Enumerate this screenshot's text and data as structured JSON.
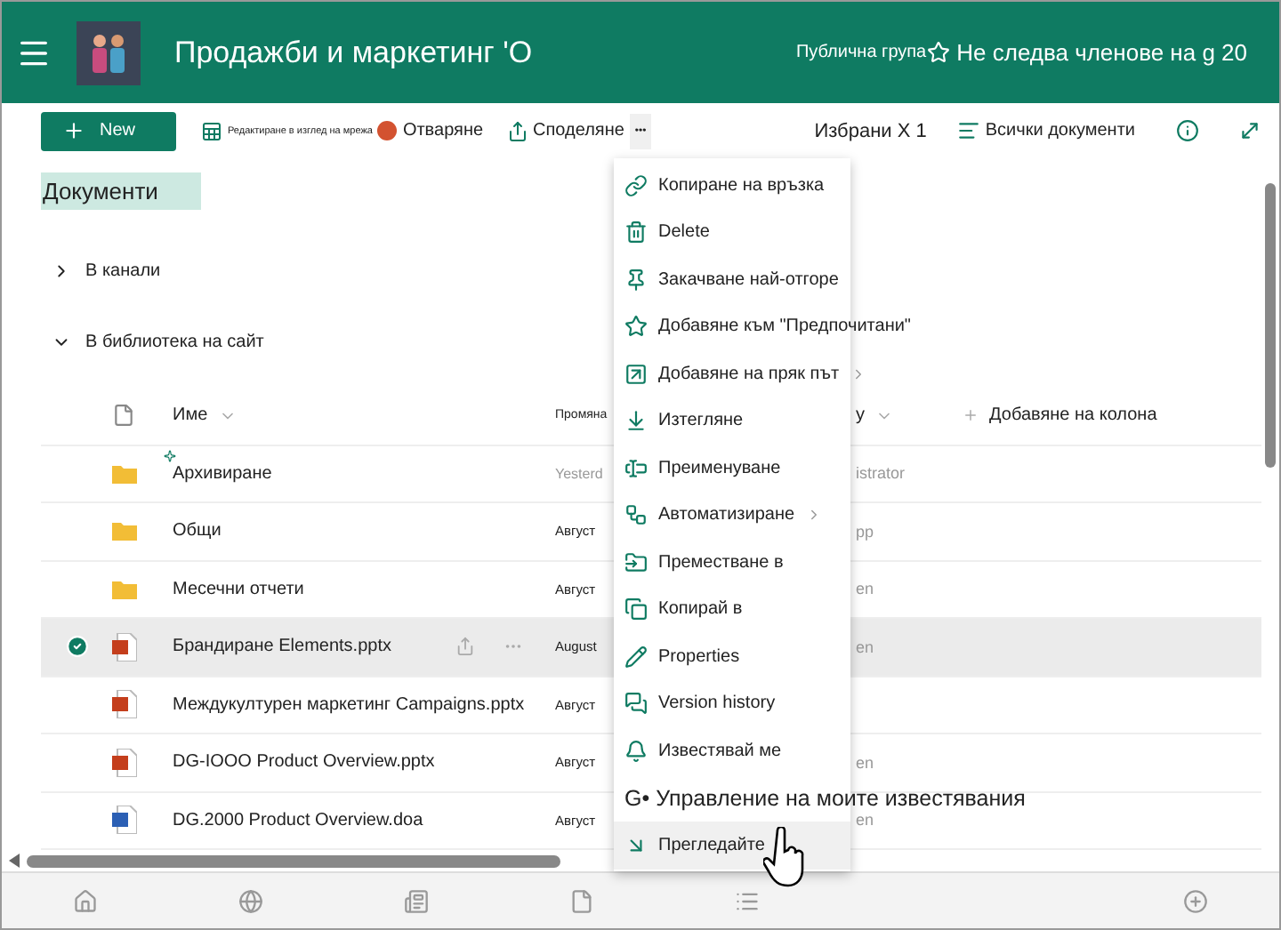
{
  "header": {
    "title": "Продажби и маркетинг 'О",
    "group_label": "Публична група",
    "follow_text": "Не следва членове на g 20",
    "following": false
  },
  "toolbar": {
    "new_button": "New",
    "edit_grid": "Редактиране в изглед на мрежа",
    "open": "Отваряне",
    "share": "Споделяне",
    "more": "•••",
    "selected_count": "Избрани X 1",
    "view": "Всички документи"
  },
  "library_title": "Документи",
  "sections": [
    {
      "label": "В канали",
      "expanded": false
    },
    {
      "label": "В библиотека на сайт",
      "expanded": true
    }
  ],
  "table": {
    "columns": {
      "name": "Име",
      "modified": "Промяна",
      "column_3": "y",
      "add_column": "Добавяне на колона"
    },
    "rows": [
      {
        "kind": "folder",
        "name": "Архивиране",
        "modified": "Yesterd",
        "modified_by": "istrator",
        "selected": false,
        "new": true
      },
      {
        "kind": "folder",
        "name": "Общи",
        "modified": "Август",
        "modified_by": "pp",
        "selected": false,
        "new": false
      },
      {
        "kind": "folder",
        "name": "Месечни отчети",
        "modified": "Август",
        "modified_by": "en",
        "selected": false,
        "new": false
      },
      {
        "kind": "pptx",
        "name": "Брандиране Elements.pptx",
        "modified": "August",
        "modified_by": "en",
        "selected": true,
        "new": false
      },
      {
        "kind": "pptx",
        "name": "Междукултурен маркетинг Campaigns.pptx",
        "modified": "Август",
        "selected": false,
        "new": false
      },
      {
        "kind": "pptx",
        "name": "DG-IOOO Product Overview.pptx",
        "modified": "Август",
        "modified_by": "en",
        "selected": false,
        "new": false
      },
      {
        "kind": "docx",
        "name": "DG.2000 Product Overview.doa",
        "modified": "Август",
        "modified_by": "en",
        "selected": false,
        "new": false
      }
    ]
  },
  "context_menu": {
    "items": [
      {
        "kind": "icon",
        "label": "Копиране на връзка",
        "submenu": false,
        "highlighted": false
      },
      {
        "kind": "icon",
        "label": "Delete",
        "submenu": false,
        "highlighted": false
      },
      {
        "kind": "icon",
        "label": "Закачване най-отгоре",
        "submenu": false,
        "highlighted": false
      },
      {
        "kind": "icon",
        "label": "Добавяне към \"Предпочитани\"",
        "submenu": false,
        "highlighted": false
      },
      {
        "kind": "icon",
        "label": "Добавяне на пряк път",
        "submenu": true,
        "highlighted": false
      },
      {
        "kind": "icon",
        "label": "Изтегляне",
        "submenu": false,
        "highlighted": false
      },
      {
        "kind": "icon",
        "label": "Преименуване",
        "submenu": false,
        "highlighted": false
      },
      {
        "kind": "icon",
        "label": "Автоматизиране",
        "submenu": true,
        "highlighted": false
      },
      {
        "kind": "icon",
        "label": "Преместване в",
        "submenu": false,
        "highlighted": false
      },
      {
        "kind": "icon",
        "label": "Копирай в",
        "submenu": false,
        "highlighted": false
      },
      {
        "kind": "icon",
        "label": "Properties",
        "submenu": false,
        "highlighted": false
      },
      {
        "kind": "icon",
        "label": "Version history",
        "submenu": false,
        "highlighted": false
      },
      {
        "kind": "icon",
        "label": "Известявай ме",
        "submenu": false,
        "highlighted": false
      },
      {
        "kind": "plain",
        "label": "G• Управление на моите известявания",
        "submenu": false,
        "highlighted": false
      },
      {
        "kind": "icon",
        "label": "Прегледайте",
        "submenu": false,
        "highlighted": true
      }
    ]
  }
}
